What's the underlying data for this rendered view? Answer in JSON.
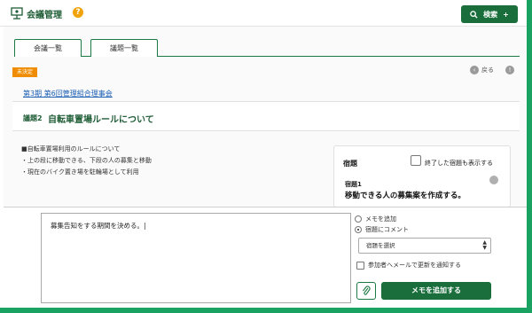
{
  "header": {
    "app_title": "会議管理",
    "help_icon": "question-icon",
    "search_label": "検索"
  },
  "tabs": [
    {
      "label": "会議一覧"
    },
    {
      "label": "議題一覧"
    }
  ],
  "status_badge": "未決定",
  "back_label": "戻る",
  "meeting_link": "第3期 第6回管理組合理事会",
  "agenda": {
    "number": "議題2",
    "title": "自転車置場ルールについて"
  },
  "body_lines": [
    "■自転車置場利用のルールについて",
    "・上の段に移動できる、下段の人の募集と移動",
    "・現在のバイク置き場を駐輪場として利用"
  ],
  "homework": {
    "title": "宿題",
    "show_done_label": "終了した宿題も表示する",
    "item_label": "宿題1",
    "item_text": "移動できる人の募集案を作成する。"
  },
  "memo": {
    "text": "募集告知をする期間を決める。|",
    "radio_add_memo": "メモを追加",
    "radio_comment": "宿題にコメント",
    "select_value": "宿題を選択",
    "notify_label": "参加者へメールで更新を通知する",
    "submit_label": "メモを追加する"
  },
  "colors": {
    "brand_green": "#1a6e3c",
    "accent_orange": "#f08c00",
    "frame_green": "#1aa263"
  }
}
